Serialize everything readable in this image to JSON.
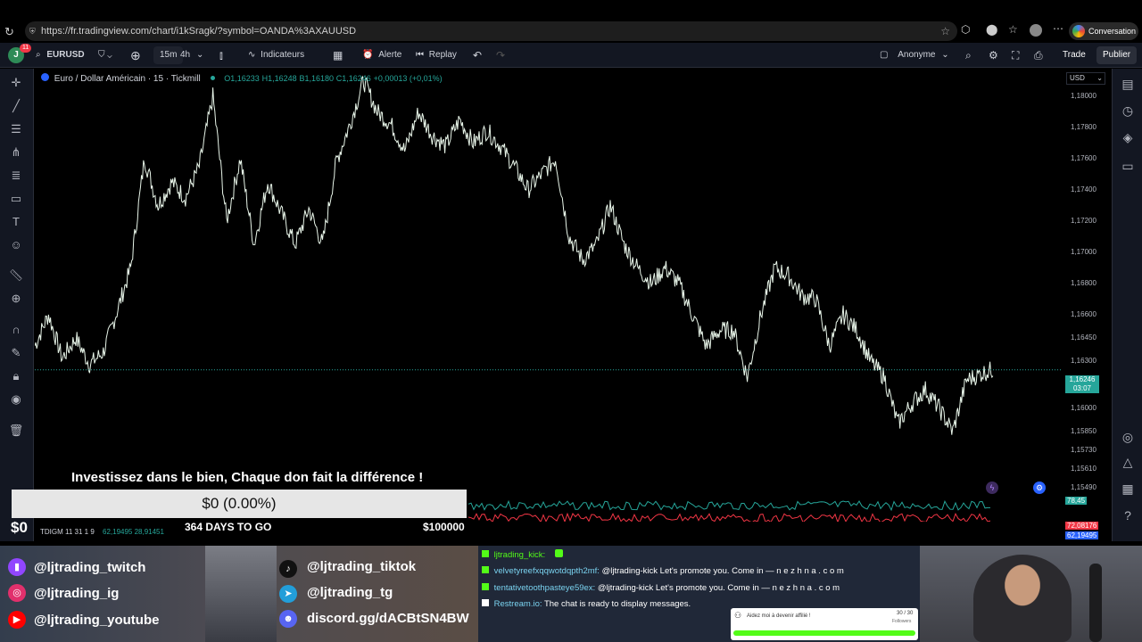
{
  "browser": {
    "url": "https://fr.tradingview.com/chart/i1kSragk/?symbol=OANDA%3AXAUUSD",
    "conversation_label": "Conversation"
  },
  "toolbar": {
    "avatar_letter": "J",
    "notif_count": "11",
    "symbol": "EURUSD",
    "interval_active": "15m",
    "interval_other": "4h",
    "indicators_label": "Indicateurs",
    "alert_label": "Alerte",
    "replay_label": "Replay",
    "layout_name": "Anonyme",
    "trade_label": "Trade",
    "publish_label": "Publier"
  },
  "legend": {
    "title": "Euro / Dollar Américain · 15 · Tickmill",
    "open": "O1,16233",
    "high": "H1,16248",
    "low": "B1,16180",
    "close": "C1,16246",
    "change": "+0,00013 (+0,01%)"
  },
  "price_axis": {
    "currency": "USD",
    "labels": [
      "1,18000",
      "1,17800",
      "1,17600",
      "1,17400",
      "1,17200",
      "1,17000",
      "1,16800",
      "1,16600",
      "1,16450",
      "1,16300",
      "1,16000",
      "1,15850",
      "1,15730",
      "1,15610",
      "1,15490"
    ],
    "current_price": "1,16246",
    "countdown": "03:07",
    "indicator_value_1": "78,45",
    "indicator_value_2": "72,08176",
    "indicator_value_3": "62,19495"
  },
  "indicator_legend": "TDIGM 11 31 1 9",
  "indicator_values": "62,19495  28,91451",
  "donation": {
    "headline": "Investissez dans le bien, Chaque don fait la différence !",
    "progress_text": "$0 (0.00%)",
    "progress_fraction": 0,
    "raised": "$0",
    "days_left": "364 DAYS TO GO",
    "goal": "$100000"
  },
  "socials": [
    {
      "icon": "twitch-icon",
      "color": "#9146ff",
      "handle": "@ljtrading_twitch"
    },
    {
      "icon": "instagram-icon",
      "color": "#e1306c",
      "handle": "@ljtrading_ig"
    },
    {
      "icon": "youtube-icon",
      "color": "#ff0000",
      "handle": "@ljtrading_youtube"
    },
    {
      "icon": "tiktok-icon",
      "color": "#111111",
      "handle": "@ljtrading_tiktok"
    },
    {
      "icon": "telegram-icon",
      "color": "#229ed9",
      "handle": "@ljtrading_tg"
    },
    {
      "icon": "discord-icon",
      "color": "#5865f2",
      "handle": "discord.gg/dACBtSN4BW"
    }
  ],
  "chat": [
    {
      "user": "ljtrading_kick:",
      "text": ""
    },
    {
      "user": "velvetyreefxqqwotdqpth2mf:",
      "text": "@ljtrading-kick Let's promote you. Come in — n e z h n a . c o m"
    },
    {
      "user": "tentativetoothpasteye59ex:",
      "text": "@ljtrading-kick Let's promote you. Come in — n e z h n a . c o m"
    },
    {
      "user": "Restream.io:",
      "text": "The chat is ready to display messages."
    }
  ],
  "affiliate": {
    "text": "Aidez moi à devenir affilié !",
    "count": "30 / 30",
    "sub": "Followers"
  },
  "chart_data": {
    "type": "line",
    "title": "Euro / Dollar Américain · 15 · Tickmill",
    "ylim": [
      1.1549,
      1.1812
    ],
    "x": [
      0,
      1,
      2,
      3,
      4,
      5,
      6,
      7,
      8,
      9,
      10,
      11,
      12,
      13,
      14,
      15,
      16,
      17,
      18,
      19,
      20,
      21,
      22,
      23,
      24,
      25,
      26,
      27,
      28,
      29,
      30,
      31,
      32,
      33,
      34,
      35,
      36,
      37,
      38,
      39,
      40,
      41,
      42,
      43,
      44,
      45,
      46,
      47,
      48,
      49,
      50,
      51,
      52,
      53,
      54,
      55,
      56,
      57,
      58,
      59,
      60,
      61,
      62,
      63,
      64,
      65,
      66,
      67,
      68,
      69,
      70
    ],
    "values": [
      1.164,
      1.166,
      1.1632,
      1.1645,
      1.1628,
      1.1636,
      1.1662,
      1.169,
      1.176,
      1.173,
      1.1745,
      1.1735,
      1.1755,
      1.18,
      1.172,
      1.176,
      1.1705,
      1.1745,
      1.1725,
      1.1705,
      1.1728,
      1.1705,
      1.1758,
      1.1782,
      1.181,
      1.179,
      1.1782,
      1.1765,
      1.179,
      1.1775,
      1.1768,
      1.1785,
      1.177,
      1.1778,
      1.1768,
      1.1755,
      1.174,
      1.175,
      1.176,
      1.171,
      1.1695,
      1.1705,
      1.173,
      1.1705,
      1.169,
      1.168,
      1.169,
      1.168,
      1.166,
      1.164,
      1.165,
      1.165,
      1.162,
      1.166,
      1.169,
      1.1685,
      1.1672,
      1.167,
      1.164,
      1.166,
      1.165,
      1.163,
      1.162,
      1.159,
      1.1603,
      1.1612,
      1.16,
      1.1585,
      1.1618,
      1.1622,
      1.1625
    ]
  }
}
